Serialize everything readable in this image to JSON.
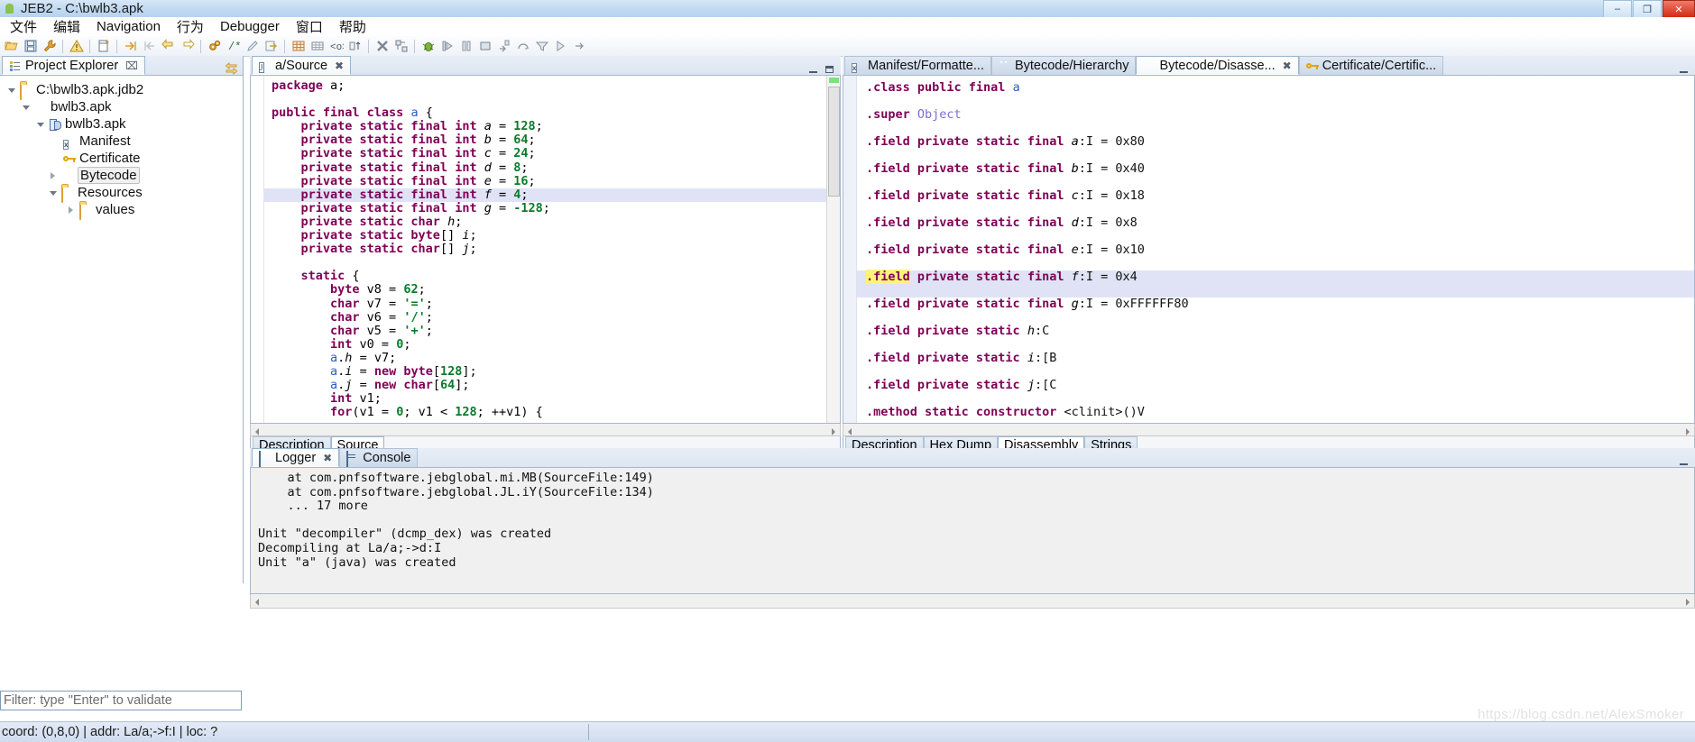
{
  "window": {
    "title": "JEB2 - C:\\bwlb3.apk",
    "app_icon": "android-icon",
    "minimize_label": "–",
    "maximize_label": "❐",
    "close_label": "✕"
  },
  "menubar": {
    "items": [
      {
        "label": "文件",
        "name": "menu-file"
      },
      {
        "label": "编辑",
        "name": "menu-edit"
      },
      {
        "label": "Navigation",
        "name": "menu-navigation"
      },
      {
        "label": "行为",
        "name": "menu-action"
      },
      {
        "label": "Debugger",
        "name": "menu-debugger"
      },
      {
        "label": "窗口",
        "name": "menu-window"
      },
      {
        "label": "帮助",
        "name": "menu-help"
      }
    ]
  },
  "toolbar": {
    "groups": [
      [
        "open-icon",
        "save-icon",
        "wrench-icon"
      ],
      [
        "warning-icon"
      ],
      [
        "new-document-icon"
      ],
      [
        "goto-forward-icon",
        "goto-back-icon",
        "back-arrow-icon",
        "forward-arrow-icon"
      ],
      [
        "gears-icon",
        "comment-icon",
        "rename-icon",
        "jump-icon"
      ],
      [
        "table-icon",
        "grid-icon",
        "code-icon",
        "sort-icon"
      ],
      [
        "terminate-icon",
        "disconnect-icon"
      ],
      [
        "debug-icon",
        "step-into-icon",
        "pause-icon",
        "stop-icon",
        "step-return-icon"
      ],
      [
        "step-over-icon",
        "step-filter-icon",
        "resume-icon",
        "run-icon"
      ]
    ]
  },
  "project_explorer": {
    "tab_label": "Project Explorer",
    "tab_icon": "project-explorer-icon",
    "close_icon": "⌧",
    "link_icon": "link-with-editor-icon",
    "tree": [
      {
        "label": "C:\\bwlb3.apk.jdb2",
        "icon": "folder-icon",
        "twisty": "open",
        "indent": 0,
        "selected": false
      },
      {
        "label": "bwlb3.apk",
        "icon": "sphere-icon",
        "twisty": "open",
        "indent": 1,
        "selected": false
      },
      {
        "label": "bwlb3.apk",
        "icon": "dex-icon",
        "twisty": "open",
        "indent": 2,
        "selected": false
      },
      {
        "label": "Manifest",
        "icon": "manifest-icon",
        "twisty": "none",
        "indent": 3,
        "selected": false
      },
      {
        "label": "Certificate",
        "icon": "key-icon",
        "twisty": "none",
        "indent": 3,
        "selected": false
      },
      {
        "label": "Bytecode",
        "icon": "android-icon",
        "twisty": "closed",
        "indent": 2,
        "selected": true
      },
      {
        "label": "Resources",
        "icon": "folder-icon",
        "twisty": "open",
        "indent": 2,
        "selected": false
      },
      {
        "label": "values",
        "icon": "folder-icon",
        "twisty": "closed",
        "indent": 3,
        "selected": false
      }
    ],
    "filter_placeholder": "Filter: type \"Enter\" to validate",
    "filter_value": ""
  },
  "source_panel": {
    "tabs": [
      {
        "label": "a/Source",
        "icon": "java-icon",
        "active": true,
        "closable": true
      }
    ],
    "bottom_tabs": [
      {
        "label": "Description",
        "active": false
      },
      {
        "label": "Source",
        "active": true
      }
    ],
    "code_lines": [
      [
        {
          "t": "package ",
          "c": "kw"
        },
        {
          "t": "a;",
          "c": "pln"
        }
      ],
      [],
      [
        {
          "t": "public final class ",
          "c": "kw"
        },
        {
          "t": "a",
          "c": "cls"
        },
        {
          "t": " {",
          "c": "pln"
        }
      ],
      [
        {
          "t": "    private static final int ",
          "c": "kw"
        },
        {
          "t": "a",
          "c": "idt"
        },
        {
          "t": " = ",
          "c": "pln"
        },
        {
          "t": "128",
          "c": "num"
        },
        {
          "t": ";",
          "c": "pln"
        }
      ],
      [
        {
          "t": "    private static final int ",
          "c": "kw"
        },
        {
          "t": "b",
          "c": "idt"
        },
        {
          "t": " = ",
          "c": "pln"
        },
        {
          "t": "64",
          "c": "num"
        },
        {
          "t": ";",
          "c": "pln"
        }
      ],
      [
        {
          "t": "    private static final int ",
          "c": "kw"
        },
        {
          "t": "c",
          "c": "idt"
        },
        {
          "t": " = ",
          "c": "pln"
        },
        {
          "t": "24",
          "c": "num"
        },
        {
          "t": ";",
          "c": "pln"
        }
      ],
      [
        {
          "t": "    private static final int ",
          "c": "kw"
        },
        {
          "t": "d",
          "c": "idt"
        },
        {
          "t": " = ",
          "c": "pln"
        },
        {
          "t": "8",
          "c": "num"
        },
        {
          "t": ";",
          "c": "pln"
        }
      ],
      [
        {
          "t": "    private static final int ",
          "c": "kw"
        },
        {
          "t": "e",
          "c": "idt"
        },
        {
          "t": " = ",
          "c": "pln"
        },
        {
          "t": "16",
          "c": "num"
        },
        {
          "t": ";",
          "c": "pln"
        }
      ],
      [
        {
          "t": "    private static final int ",
          "c": "kw"
        },
        {
          "t": "f",
          "c": "idt"
        },
        {
          "t": " = ",
          "c": "pln"
        },
        {
          "t": "4",
          "c": "num"
        },
        {
          "t": ";",
          "c": "pln"
        }
      ],
      [
        {
          "t": "    private static final int ",
          "c": "kw"
        },
        {
          "t": "g",
          "c": "idt"
        },
        {
          "t": " = ",
          "c": "pln"
        },
        {
          "t": "-128",
          "c": "num"
        },
        {
          "t": ";",
          "c": "pln"
        }
      ],
      [
        {
          "t": "    private static char ",
          "c": "kw"
        },
        {
          "t": "h",
          "c": "idt"
        },
        {
          "t": ";",
          "c": "pln"
        }
      ],
      [
        {
          "t": "    private static byte",
          "c": "kw"
        },
        {
          "t": "[] ",
          "c": "pln"
        },
        {
          "t": "i",
          "c": "idt"
        },
        {
          "t": ";",
          "c": "pln"
        }
      ],
      [
        {
          "t": "    private static char",
          "c": "kw"
        },
        {
          "t": "[] ",
          "c": "pln"
        },
        {
          "t": "j",
          "c": "idt"
        },
        {
          "t": ";",
          "c": "pln"
        }
      ],
      [],
      [
        {
          "t": "    static ",
          "c": "kw"
        },
        {
          "t": "{",
          "c": "pln"
        }
      ],
      [
        {
          "t": "        byte ",
          "c": "kw"
        },
        {
          "t": "v8 = ",
          "c": "pln"
        },
        {
          "t": "62",
          "c": "num"
        },
        {
          "t": ";",
          "c": "pln"
        }
      ],
      [
        {
          "t": "        char ",
          "c": "kw"
        },
        {
          "t": "v7 = ",
          "c": "pln"
        },
        {
          "t": "'='",
          "c": "chr"
        },
        {
          "t": ";",
          "c": "pln"
        }
      ],
      [
        {
          "t": "        char ",
          "c": "kw"
        },
        {
          "t": "v6 = ",
          "c": "pln"
        },
        {
          "t": "'/'",
          "c": "chr"
        },
        {
          "t": ";",
          "c": "pln"
        }
      ],
      [
        {
          "t": "        char ",
          "c": "kw"
        },
        {
          "t": "v5 = ",
          "c": "pln"
        },
        {
          "t": "'+'",
          "c": "chr"
        },
        {
          "t": ";",
          "c": "pln"
        }
      ],
      [
        {
          "t": "        int ",
          "c": "kw"
        },
        {
          "t": "v0 = ",
          "c": "pln"
        },
        {
          "t": "0",
          "c": "num"
        },
        {
          "t": ";",
          "c": "pln"
        }
      ],
      [
        {
          "t": "        a",
          "c": "cls"
        },
        {
          "t": ".",
          "c": "pln"
        },
        {
          "t": "h",
          "c": "idt"
        },
        {
          "t": " = v7;",
          "c": "pln"
        }
      ],
      [
        {
          "t": "        a",
          "c": "cls"
        },
        {
          "t": ".",
          "c": "pln"
        },
        {
          "t": "i",
          "c": "idt"
        },
        {
          "t": " = ",
          "c": "pln"
        },
        {
          "t": "new byte",
          "c": "kw"
        },
        {
          "t": "[",
          "c": "pln"
        },
        {
          "t": "128",
          "c": "num"
        },
        {
          "t": "];",
          "c": "pln"
        }
      ],
      [
        {
          "t": "        a",
          "c": "cls"
        },
        {
          "t": ".",
          "c": "pln"
        },
        {
          "t": "j",
          "c": "idt"
        },
        {
          "t": " = ",
          "c": "pln"
        },
        {
          "t": "new char",
          "c": "kw"
        },
        {
          "t": "[",
          "c": "pln"
        },
        {
          "t": "64",
          "c": "num"
        },
        {
          "t": "];",
          "c": "pln"
        }
      ],
      [
        {
          "t": "        int ",
          "c": "kw"
        },
        {
          "t": "v1;",
          "c": "pln"
        }
      ],
      [
        {
          "t": "        for",
          "c": "kw"
        },
        {
          "t": "(v1 = ",
          "c": "pln"
        },
        {
          "t": "0",
          "c": "num"
        },
        {
          "t": "; v1 < ",
          "c": "pln"
        },
        {
          "t": "128",
          "c": "num"
        },
        {
          "t": "; ++v1) {",
          "c": "pln"
        }
      ]
    ],
    "highlighted_line_index": 8
  },
  "bytecode_panel": {
    "tabs": [
      {
        "label": "Manifest/Formatte...",
        "icon": "manifest-icon",
        "active": false,
        "closable": false
      },
      {
        "label": "Bytecode/Hierarchy",
        "icon": "android-icon",
        "active": false,
        "closable": false
      },
      {
        "label": "Bytecode/Disasse...",
        "icon": "android-icon",
        "active": true,
        "closable": true
      },
      {
        "label": "Certificate/Certific...",
        "icon": "key-icon",
        "active": false,
        "closable": false
      }
    ],
    "bottom_tabs": [
      {
        "label": "Description",
        "active": false
      },
      {
        "label": "Hex Dump",
        "active": false
      },
      {
        "label": "Disassembly",
        "active": true
      },
      {
        "label": "Strings",
        "active": false
      }
    ],
    "code_lines": [
      [
        {
          "t": ".class public final ",
          "c": "bckw"
        },
        {
          "t": "a",
          "c": "bccls"
        }
      ],
      [
        {
          "t": ".super ",
          "c": "bckw"
        },
        {
          "t": "Object",
          "c": "bcobj"
        }
      ],
      [
        {
          "t": ".field private static final ",
          "c": "bckw"
        },
        {
          "t": "a",
          "c": "bcid"
        },
        {
          "t": ":I = 0x80",
          "c": "bctxt"
        }
      ],
      [
        {
          "t": ".field private static final ",
          "c": "bckw"
        },
        {
          "t": "b",
          "c": "bcid"
        },
        {
          "t": ":I = 0x40",
          "c": "bctxt"
        }
      ],
      [
        {
          "t": ".field private static final ",
          "c": "bckw"
        },
        {
          "t": "c",
          "c": "bcid"
        },
        {
          "t": ":I = 0x18",
          "c": "bctxt"
        }
      ],
      [
        {
          "t": ".field private static final ",
          "c": "bckw"
        },
        {
          "t": "d",
          "c": "bcid"
        },
        {
          "t": ":I = 0x8",
          "c": "bctxt"
        }
      ],
      [
        {
          "t": ".field private static final ",
          "c": "bckw"
        },
        {
          "t": "e",
          "c": "bcid"
        },
        {
          "t": ":I = 0x10",
          "c": "bctxt"
        }
      ],
      [
        {
          "t": ".field",
          "c": "bckw mark"
        },
        {
          "t": " private static final ",
          "c": "bckw"
        },
        {
          "t": "f",
          "c": "bcid"
        },
        {
          "t": ":I = 0x4",
          "c": "bctxt"
        }
      ],
      [
        {
          "t": ".field private static final ",
          "c": "bckw"
        },
        {
          "t": "g",
          "c": "bcid"
        },
        {
          "t": ":I = 0xFFFFFF80",
          "c": "bctxt"
        }
      ],
      [
        {
          "t": ".field private static ",
          "c": "bckw"
        },
        {
          "t": "h",
          "c": "bcid"
        },
        {
          "t": ":C",
          "c": "bctxt"
        }
      ],
      [
        {
          "t": ".field private static ",
          "c": "bckw"
        },
        {
          "t": "i",
          "c": "bcid"
        },
        {
          "t": ":[B",
          "c": "bctxt"
        }
      ],
      [
        {
          "t": ".field private static ",
          "c": "bckw"
        },
        {
          "t": "j",
          "c": "bcid"
        },
        {
          "t": ":[C",
          "c": "bctxt"
        }
      ],
      [
        {
          "t": ".method static constructor ",
          "c": "bckw"
        },
        {
          "t": "<clinit>()V",
          "c": "bctxt"
        }
      ]
    ],
    "highlighted_line_index": 7
  },
  "logger_panel": {
    "tabs": [
      {
        "label": "Logger",
        "icon": "logger-icon",
        "active": true,
        "closable": true
      },
      {
        "label": "Console",
        "icon": "console-icon",
        "active": false,
        "closable": false
      }
    ],
    "lines": [
      "    at com.pnfsoftware.jebglobal.mi.MB(SourceFile:149)",
      "    at com.pnfsoftware.jebglobal.JL.iY(SourceFile:134)",
      "    ... 17 more",
      "",
      "Unit \"decompiler\" (dcmp_dex) was created",
      "Decompiling at La/a;->d:I",
      "Unit \"a\" (java) was created"
    ]
  },
  "statusbar": {
    "text": "coord: (0,8,0) | addr: La/a;->f:I | loc: ?"
  },
  "watermark": {
    "text": "https://blog.csdn.net/AlexSmoker"
  }
}
